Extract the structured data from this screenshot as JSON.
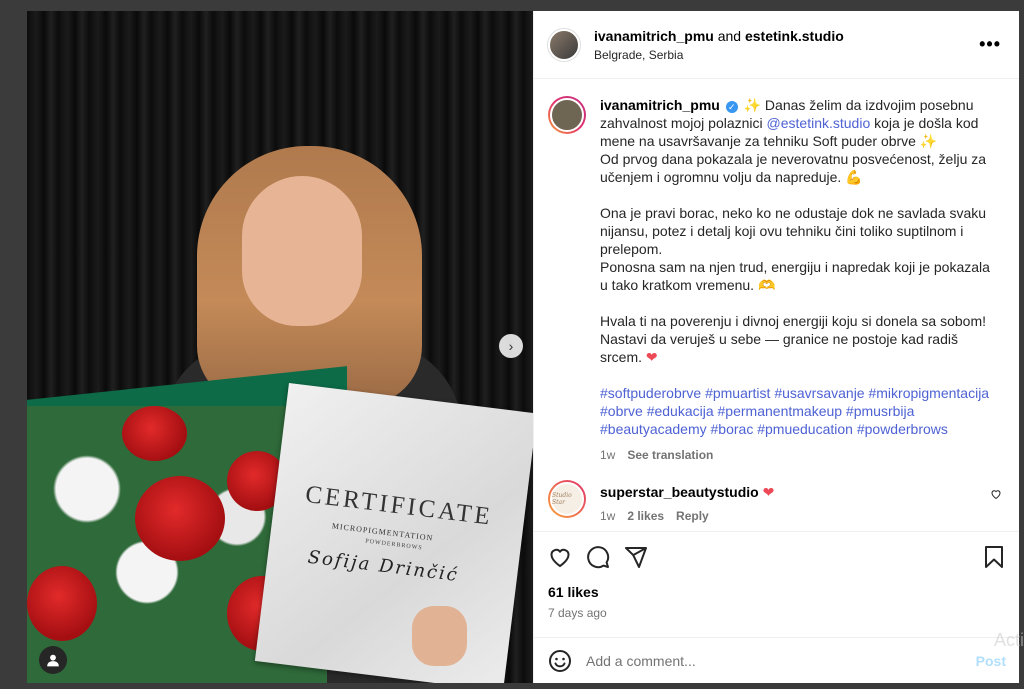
{
  "header": {
    "username": "ivanamitrich_pmu",
    "connector": " and ",
    "collaborator": "estetink.studio",
    "location": "Belgrade, Serbia",
    "more_icon": "more-horizontal-icon",
    "more_label": "•••"
  },
  "caption": {
    "username": "ivanamitrich_pmu",
    "line1": "✨ Danas želim da izdvojim posebnu zahvalnost mojoj polaznici ",
    "mention": "@estetink.studio",
    "line1_end": " koja je došla kod mene na usavršavanje za tehniku Soft puder obrve ✨",
    "line2": "Od prvog dana pokazala je neverovatnu posvećenost, želju za učenjem i ogromnu volju da napreduje. 💪",
    "line3": "Ona je pravi borac, neko ko ne odustaje dok ne savlada svaku nijansu, potez i detalj koji ovu tehniku čini toliko suptilnom i prelepom.",
    "line4": "Ponosna sam na njen trud, energiju i napredak koji je pokazala u tako kratkom vremenu. 🫶",
    "line5": "Hvala ti na poverenju i divnoj energiji koju si donela sa sobom! Nastavi da veruješ u sebe — granice ne postoje kad radiš srcem.",
    "heart": "❤",
    "hashtags": "#softpuderobrve #pmuartist #usavrsavanje #mikropigmentacija #obrve #edukacija #permanentmakeup #pmusrbija #beautyacademy #borac #pmueducation #powderbrows",
    "age": "1w",
    "see_translation": "See translation"
  },
  "comment": {
    "username": "superstar_beautystudio",
    "avatar_text": "Studio Star",
    "heart": "❤",
    "age": "1w",
    "likes": "2 likes",
    "reply": "Reply"
  },
  "actions": {
    "likes": "61 likes",
    "ago": "7 days ago"
  },
  "composer": {
    "placeholder": "Add a comment...",
    "post": "Post"
  },
  "media": {
    "certificate_title": "CERTIFICATE",
    "certificate_sub": "MICROPIGMENTATION",
    "certificate_sub2": "POWDERBROWS",
    "certificate_name": "Sofija Drinčić",
    "next_label": "›"
  },
  "watermark": "Acti",
  "colors": {
    "link": "#4e62d4",
    "heart": "#ed4956",
    "post_disabled": "#b2dffc"
  }
}
